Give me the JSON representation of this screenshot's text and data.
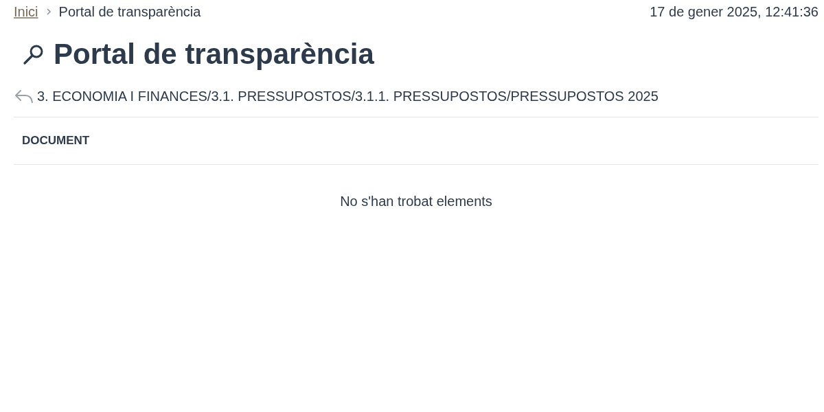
{
  "breadcrumb": [
    {
      "label": "Inici",
      "kind": "link"
    },
    {
      "label": "Portal de transparència",
      "kind": "current"
    }
  ],
  "timestamp": "17 de gener 2025, 12:41:36",
  "title": "Portal de transparència",
  "path": "3. ECONOMIA I FINANCES/3.1. PRESSUPOSTOS/3.1.1. PRESSUPOSTOS/PRESSUPOSTOS 2025",
  "table": {
    "columns": [
      "DOCUMENT"
    ],
    "empty_message": "No s'han trobat elements"
  }
}
